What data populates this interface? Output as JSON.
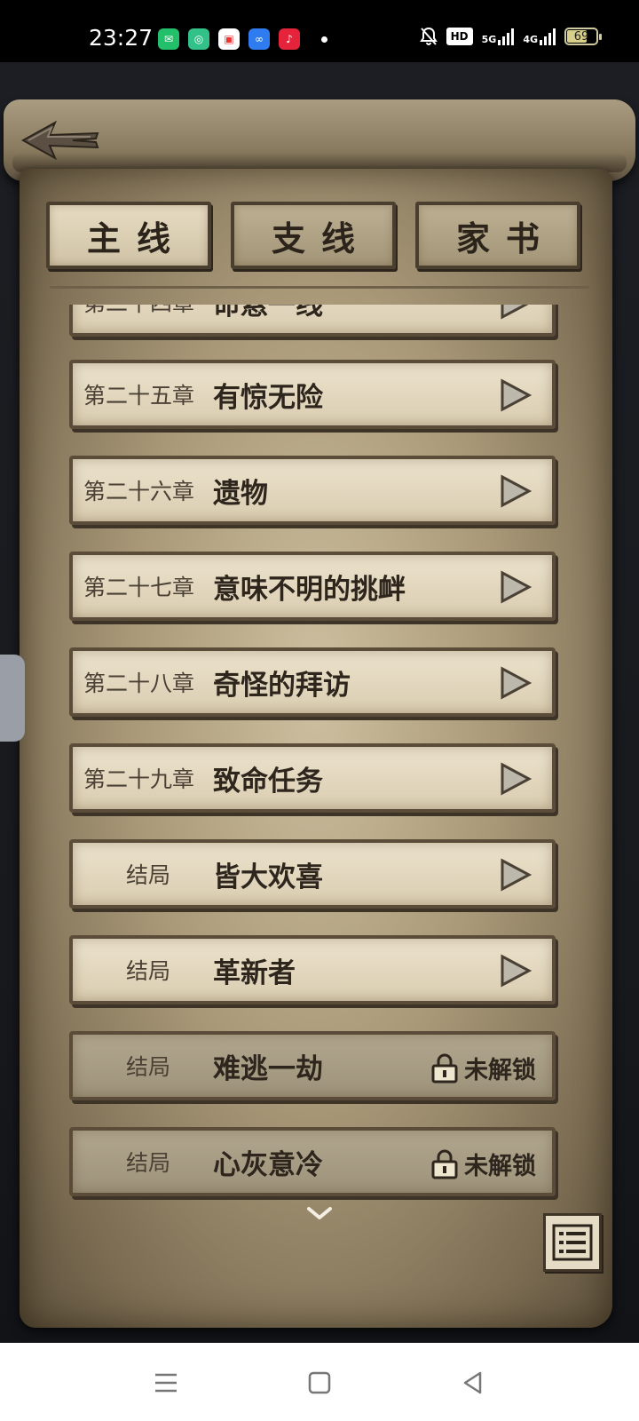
{
  "status_bar": {
    "time": "23:27",
    "app_icons": [
      {
        "name": "wechat-work-icon",
        "color": "#22c06a"
      },
      {
        "name": "vpn-icon",
        "color": "#33c18a"
      },
      {
        "name": "game-center-icon",
        "color": "#ffffff"
      },
      {
        "name": "infinity-app-icon",
        "color": "#2f7cf0"
      },
      {
        "name": "netease-music-icon",
        "color": "#e5233a"
      }
    ],
    "network_5g": "5G",
    "network_4g": "4G",
    "battery": "69",
    "battery_level": 0.69
  },
  "tabs": [
    {
      "label": "主线",
      "active": true
    },
    {
      "label": "支线",
      "active": false
    },
    {
      "label": "家书",
      "active": false
    }
  ],
  "chapters": [
    {
      "number": "第二十四章",
      "title": "命悬一线",
      "locked": false
    },
    {
      "number": "第二十五章",
      "title": "有惊无险",
      "locked": false
    },
    {
      "number": "第二十六章",
      "title": "遗物",
      "locked": false
    },
    {
      "number": "第二十七章",
      "title": "意味不明的挑衅",
      "locked": false
    },
    {
      "number": "第二十八章",
      "title": "奇怪的拜访",
      "locked": false
    },
    {
      "number": "第二十九章",
      "title": "致命任务",
      "locked": false
    },
    {
      "number": "结局",
      "title": "皆大欢喜",
      "locked": false
    },
    {
      "number": "结局",
      "title": "革新者",
      "locked": false
    },
    {
      "number": "结局",
      "title": "难逃一劫",
      "locked": true
    },
    {
      "number": "结局",
      "title": "心灰意冷",
      "locked": true
    }
  ],
  "locked_label": "未解锁"
}
